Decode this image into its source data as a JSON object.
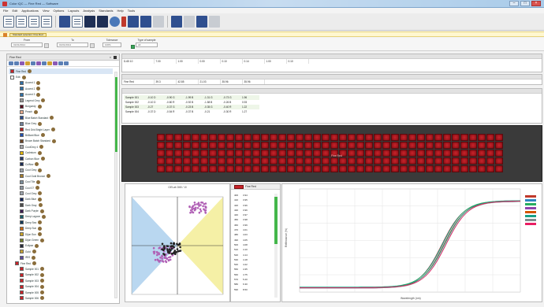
{
  "window": {
    "title": "Color iQC — Fine Red — Software",
    "minimize": "–",
    "maximize": "□",
    "close": "×"
  },
  "menu": [
    "File",
    "Edit",
    "Applications",
    "View",
    "Options",
    "Layouts",
    "Analysis",
    "Standards",
    "Help",
    "Tools"
  ],
  "toolbar": {
    "icons": [
      "new-doc-icon",
      "open-doc-icon",
      "save-doc-icon",
      "print-icon",
      "measure-icon",
      "table-icon",
      "chart-icon",
      "gear-icon",
      "report-icon",
      "export-icon",
      "palette-icon",
      "grid-icon",
      "camera-icon",
      "window-icon"
    ]
  },
  "alert": {
    "text": "Standard selection: Fine Red"
  },
  "filters": {
    "from_label": "From",
    "from_value": "01/01/2014",
    "to_label": "To",
    "to_value": "01/01/2014",
    "tolerance_label": "Tolerance",
    "tolerance_value": "100%",
    "type_label": "Type of sample",
    "type_value": "All"
  },
  "left_panel": {
    "title": "Fine Red",
    "close": "×",
    "items": [
      {
        "label": "Fine Red",
        "color": "#c8232a",
        "selected": true
      },
      {
        "label": "Edit",
        "color": "#ffffff"
      },
      {
        "label": "Accent 1",
        "color": "#2e6fa5"
      },
      {
        "label": "Accent 2",
        "color": "#2e6fa5"
      },
      {
        "label": "Accent 3",
        "color": "#2e6fa5"
      },
      {
        "label": "Legend Grey",
        "color": "#999999"
      },
      {
        "label": "Burgundy",
        "color": "#5a1020"
      },
      {
        "label": "Peach",
        "color": "#e6a98a"
      },
      {
        "label": "Blue Batch Standard",
        "color": "#2b4d8c"
      },
      {
        "label": "Blue Grey",
        "color": "#6d7f99"
      },
      {
        "label": "Red Grid Bright Layer",
        "color": "#b52222"
      },
      {
        "label": "Brilliant Blue",
        "color": "#1f4fb0"
      },
      {
        "label": "Brown Batch Standard",
        "color": "#6b4423"
      },
      {
        "label": "CoolGrey 4",
        "color": "#a7a9ac"
      },
      {
        "label": "Cadmium",
        "color": "#e0b400"
      },
      {
        "label": "Carbon Blue",
        "color": "#283c6e"
      },
      {
        "label": "ColNav",
        "color": "#1b2b55"
      },
      {
        "label": "Cool Grey",
        "color": "#9aa0a8"
      },
      {
        "label": "Cool Gold Bronze",
        "color": "#a37c2c"
      },
      {
        "label": "Cool Tile",
        "color": "#7c8f9c"
      },
      {
        "label": "Cool 07",
        "color": "#8d97a0"
      },
      {
        "label": "Cool Grey",
        "color": "#9ba3ab"
      },
      {
        "label": "Dark Blue",
        "color": "#12245a"
      },
      {
        "label": "Dark Gray",
        "color": "#4a4a4a"
      },
      {
        "label": "Dark Purple",
        "color": "#3d1d52"
      },
      {
        "label": "Deep Lagoon",
        "color": "#1b5e6b"
      },
      {
        "label": "Deep Sea",
        "color": "#123a5a"
      },
      {
        "label": "Deep Sun",
        "color": "#c76a14"
      },
      {
        "label": "Dijon Sun",
        "color": "#c9a227"
      },
      {
        "label": "Dijon Green",
        "color": "#6f7d2a"
      },
      {
        "label": "Eclipse",
        "color": "#262b3a"
      },
      {
        "label": "Gold",
        "color": "#c7a233"
      },
      {
        "label": "IRIS",
        "color": "#5b4b9a"
      },
      {
        "label": "Fine Red",
        "color": "#c8232a"
      },
      {
        "label": "Sample 001",
        "color": "#c8232a"
      },
      {
        "label": "Sample 002",
        "color": "#c8232a"
      },
      {
        "label": "Sample 003",
        "color": "#c8232a"
      },
      {
        "label": "Sample 004",
        "color": "#c8232a"
      },
      {
        "label": "Sample 005",
        "color": "#c8232a"
      },
      {
        "label": "Sample 006",
        "color": "#c8232a"
      },
      {
        "label": "Sample 007",
        "color": "#c8232a"
      }
    ]
  },
  "standard_table": {
    "row1": [
      "D-65 10",
      "7.00",
      "1.00",
      "0.00",
      "0.10",
      "0.14",
      "1.00",
      "0.10"
    ],
    "row2": [
      "Fine Red",
      "39.3",
      "42.85",
      "21.03",
      "35.96",
      "35.96"
    ]
  },
  "sample_table": {
    "rows": [
      [
        "Sample 001",
        "-0.10 D",
        "-0.90 G",
        "-1.99 B",
        "-1.31 G",
        "-0.73 G",
        "1.96"
      ],
      [
        "Sample 002",
        "-0.10 D",
        "-0.80 R",
        "-0.92 B",
        "-1.58 B",
        "-0.26 B",
        "0.93"
      ],
      [
        "Sample 003",
        "-0.27",
        "-0.37 G",
        "-0.23 B",
        "-0.35 G",
        "-0.40 R",
        "1.22"
      ],
      [
        "Sample 004",
        "-0.37 D",
        "-0.54 R",
        "-0.37 B",
        "-0.21",
        "-0.30 R",
        "1.27"
      ]
    ]
  },
  "red_strip": {
    "label": "Fine Red",
    "rows": 5,
    "cols": 40
  },
  "scatter": {
    "title": "CIELab  D65 / 10"
  },
  "sample_list": {
    "header": "Fine Red",
    "rows": [
      [
        "400",
        "3.94"
      ],
      [
        "410",
        "3.95"
      ],
      [
        "420",
        "3.96"
      ],
      [
        "430",
        "3.96"
      ],
      [
        "440",
        "3.97"
      ],
      [
        "450",
        "3.98"
      ],
      [
        "460",
        "3.99"
      ],
      [
        "470",
        "4.01"
      ],
      [
        "480",
        "4.03"
      ],
      [
        "490",
        "4.05"
      ],
      [
        "500",
        "4.08"
      ],
      [
        "510",
        "4.10"
      ],
      [
        "520",
        "4.14"
      ],
      [
        "530",
        "4.18"
      ],
      [
        "540",
        "4.22"
      ],
      [
        "550",
        "4.35"
      ],
      [
        "560",
        "4.75"
      ],
      [
        "570",
        "5.20"
      ],
      [
        "580",
        "6.30"
      ],
      [
        "590",
        "8.50"
      ]
    ]
  },
  "spectral": {
    "xlabel": "Wavelength (nm)",
    "ylabel": "Reflectance (%)"
  },
  "colors": {
    "accent_red": "#c8232a",
    "selected": "#d9e6f5",
    "scroll_green": "#44b64a"
  }
}
